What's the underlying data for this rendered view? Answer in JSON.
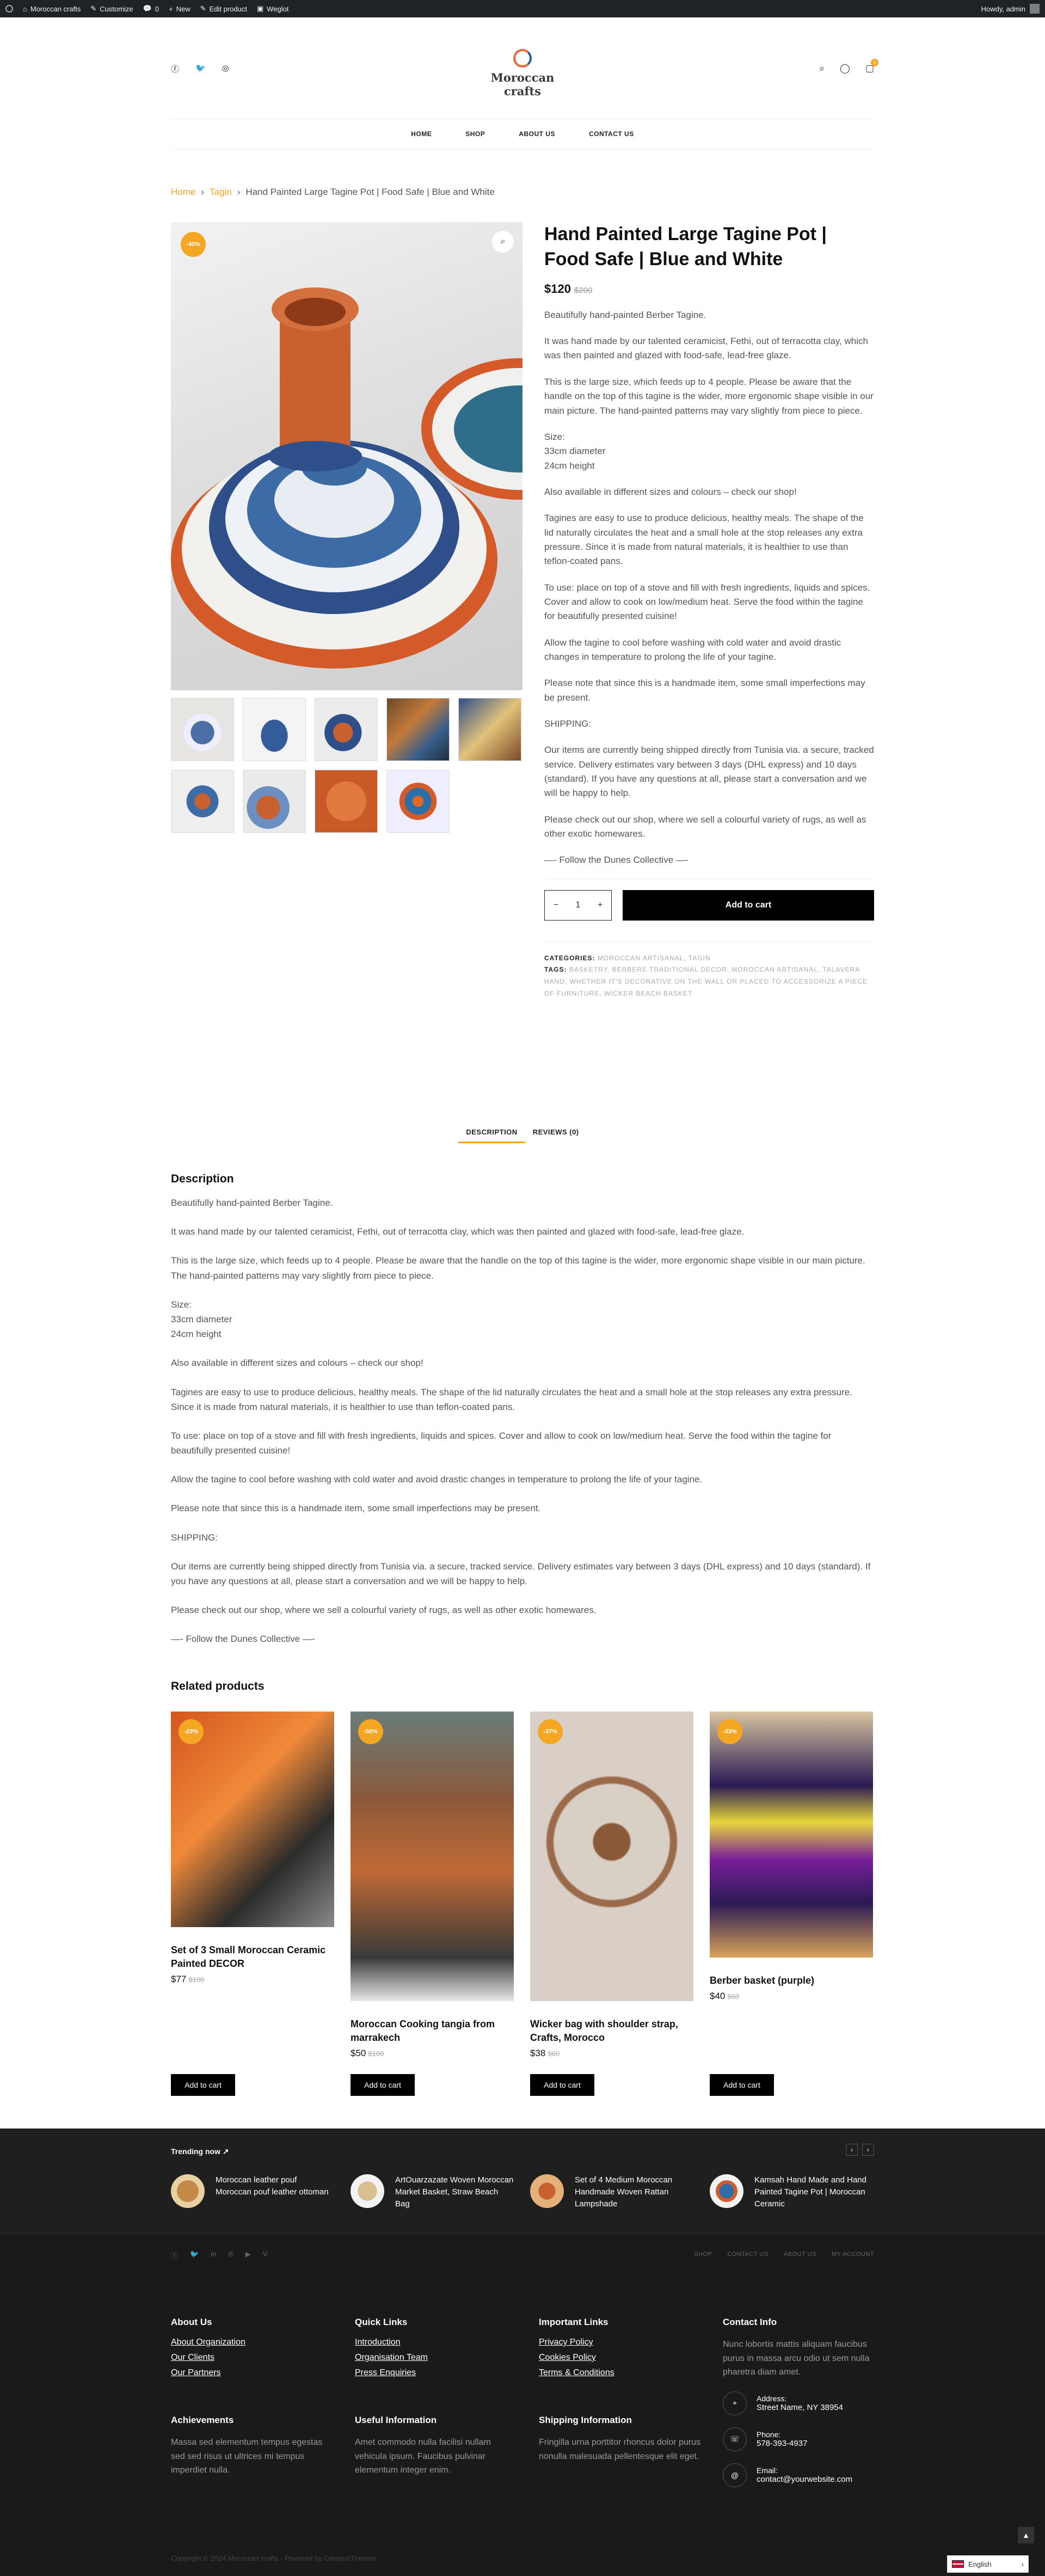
{
  "adminbar": {
    "site": "Moroccan crafts",
    "customize": "Customize",
    "comments": "0",
    "new": "New",
    "edit": "Edit product",
    "weglot": "Weglot",
    "howdy": "Howdy, admin"
  },
  "header": {
    "logo_text": "Moroccan crafts",
    "social_icons": [
      "facebook-icon",
      "twitter-icon",
      "instagram-icon"
    ],
    "cart_count": "0",
    "nav": [
      "HOME",
      "SHOP",
      "ABOUT US",
      "CONTACT US"
    ]
  },
  "breadcrumb": {
    "home": "Home",
    "category": "Tagin",
    "current": "Hand Painted Large Tagine Pot | Food Safe | Blue and White"
  },
  "product": {
    "sale_badge": "-40%",
    "title": "Hand Painted Large Tagine Pot | Food Safe | Blue and White",
    "price": "$120",
    "old_price": "$200",
    "summary": [
      "Beautifully hand-painted Berber Tagine.",
      "It was hand made by our talented ceramicist, Fethi, out of terracotta clay, which was then painted and glazed with food-safe, lead-free glaze.",
      "This is the large size, which feeds up to 4 people. Please be aware that the handle on the top of this tagine is the wider, more ergonomic shape visible in our main picture. The hand-painted patterns may vary slightly from piece to piece.",
      "Size:\n33cm diameter\n24cm height",
      "Also available in different sizes and colours – check our shop!",
      "Tagines are easy to use to produce delicious, healthy meals. The shape of the lid naturally circulates the heat and a small hole at the stop releases any extra pressure. Since it is made from natural materials, it is healthier to use than teflon-coated pans.",
      "To use: place on top of a stove and fill with fresh ingredients, liquids and spices. Cover and allow to cook on low/medium heat. Serve the food within the tagine for beautifully presented cuisine!",
      "Allow the tagine to cool before washing with cold water and avoid drastic changes in temperature to prolong the life of your tagine.",
      "Please note that since this is a handmade item, some small imperfections may be present.",
      "SHIPPING:",
      "Our items are currently being shipped directly from Tunisia via. a secure, tracked service. Delivery estimates vary between 3 days (DHL express) and 10 days (standard). If you have any questions at all, please start a conversation and we will be happy to help.",
      "Please check out our shop, where we sell a colourful variety of rugs, as well as other exotic homewares.",
      "—- Follow the Dunes Collective —-"
    ],
    "qty": "1",
    "qty_minus": "−",
    "qty_plus": "+",
    "add_to_cart": "Add to cart",
    "categories_label": "CATEGORIES:",
    "categories": "MOROCCAN ARTISANAL, TAGIN",
    "tags_label": "TAGS:",
    "tags": "BASKETRY, BERBERE TRADITIONAL DECOR, MOROCCAN ARTISANAL, TALAVERA HAND, WHETHER IT'S DECORATIVE ON THE WALL OR PLACED TO ACCESSORIZE A PIECE OF FURNITURE, WICKER BEACH BASKET"
  },
  "tabs": {
    "description": "DESCRIPTION",
    "reviews": "REVIEWS (0)"
  },
  "description": {
    "heading": "Description",
    "paragraphs": [
      "Beautifully hand-painted Berber Tagine.",
      "It was hand made by our talented ceramicist, Fethi, out of terracotta clay, which was then painted and glazed with food-safe, lead-free glaze.",
      "This is the large size, which feeds up to 4 people. Please be aware that the handle on the top of this tagine is the wider, more ergonomic shape visible in our main picture. The hand-painted patterns may vary slightly from piece to piece.",
      "Size:\n33cm diameter\n24cm height",
      "Also available in different sizes and colours – check our shop!",
      "Tagines are easy to use to produce delicious, healthy meals. The shape of the lid naturally circulates the heat and a small hole at the stop releases any extra pressure. Since it is made from natural materials, it is healthier to use than teflon-coated pans.",
      "To use: place on top of a stove and fill with fresh ingredients, liquids and spices. Cover and allow to cook on low/medium heat. Serve the food within the tagine for beautifully presented cuisine!",
      "Allow the tagine to cool before washing with cold water and avoid drastic changes in temperature to prolong the life of your tagine.",
      "Please note that since this is a handmade item, some small imperfections may be present.",
      "SHIPPING:",
      "Our items are currently being shipped directly from Tunisia via. a secure, tracked service. Delivery estimates vary between 3 days (DHL express) and 10 days (standard). If you have any questions at all, please start a conversation and we will be happy to help.",
      "Please check out our shop, where we sell a colourful variety of rugs, as well as other exotic homewares.",
      "—- Follow the Dunes Collective —-"
    ]
  },
  "related": {
    "title": "Related products",
    "items": [
      {
        "badge": "-23%",
        "name": "Set of 3 Small Moroccan Ceramic Painted DECOR",
        "price": "$77",
        "old": "$100",
        "btn": "Add to cart"
      },
      {
        "badge": "-50%",
        "name": "Moroccan Cooking tangia from marrakech",
        "price": "$50",
        "old": "$100",
        "btn": "Add to cart"
      },
      {
        "badge": "-37%",
        "name": "Wicker bag with shoulder strap, Crafts, Morocco",
        "price": "$38",
        "old": "$60",
        "btn": "Add to cart"
      },
      {
        "badge": "-33%",
        "name": "Berber basket (purple)",
        "price": "$40",
        "old": "$60",
        "btn": "Add to cart"
      }
    ]
  },
  "trending": {
    "title": "Trending now",
    "items": [
      "Moroccan leather pouf Moroccan pouf leather ottoman",
      "ArtOuarzazate Woven Moroccan Market Basket, Straw Beach Bag",
      "Set of 4 Medium Moroccan Handmade Woven Rattan Lampshade",
      "Kamsah Hand Made and Hand Painted Tagine Pot | Moroccan Ceramic"
    ]
  },
  "social_bar": {
    "links": [
      "SHOP",
      "CONTACT US",
      "ABOUT US",
      "MY ACCOUNT"
    ]
  },
  "footer": {
    "about_title": "About Us",
    "about_links": [
      "About Organization",
      "Our Clients",
      "Our Partners"
    ],
    "quick_title": "Quick Links",
    "quick_links": [
      "Introduction",
      "Organisation Team",
      "Press Enquiries"
    ],
    "important_title": "Important Links",
    "important_links": [
      "Privacy Policy",
      "Cookies Policy",
      "Terms & Conditions"
    ],
    "contact_title": "Contact Info",
    "contact_text": "Nunc lobortis mattis aliquam faucibus purus in massa arcu odio ut sem nulla pharetra diam amet.",
    "achievements_title": "Achievements",
    "achievements_text": "Massa sed elementum tempus egestas sed sed risus ut ultrices mi tempus imperdiet nulla.",
    "useful_title": "Useful Information",
    "useful_text": "Amet commodo nulla facilisi nullam vehicula ipsum. Faucibus pulvinar elementum integer enim.",
    "shipping_title": "Shipping Information",
    "shipping_text": "Fringilla urna porttitor rhoncus dolor purus nonulla malesuada pellentesque elit eget.",
    "address_label": "Address:",
    "address_value": "Street Name, NY 38954",
    "phone_label": "Phone:",
    "phone_value": "578-393-4937",
    "email_label": "Email:",
    "email_value": "contact@yourwebsite.com",
    "copyright": "Copyright © 2024 Moroccan crafts · Powered by CreativeThemes"
  },
  "language": "English"
}
